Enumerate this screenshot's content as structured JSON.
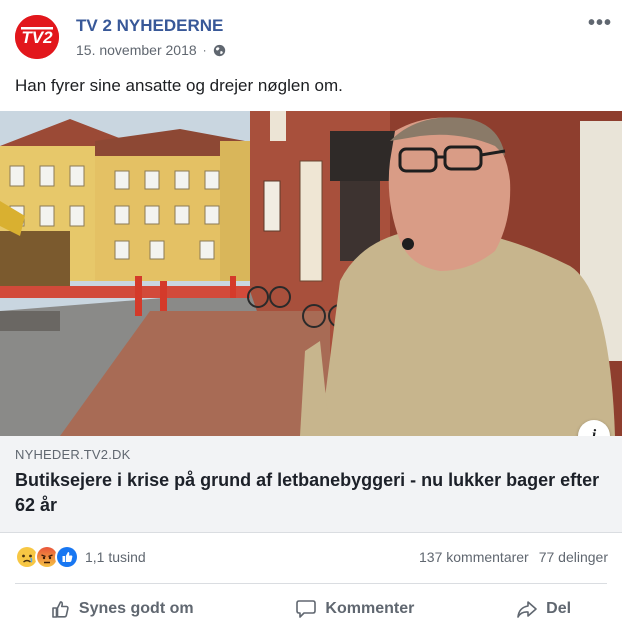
{
  "post": {
    "page_name": "TV 2 NYHEDERNE",
    "date": "15. november 2018",
    "privacy_icon": "globe-icon",
    "more_label": "•••",
    "text": "Han fyrer sine ansatte og drejer nøglen om.",
    "logo_text": "TV2"
  },
  "link": {
    "domain": "NYHEDER.TV2.DK",
    "title": "Butiksejere i krise på grund af letbanebyggeri - nu lukker bager efter 62 år",
    "info_label": "i"
  },
  "reactions": {
    "icons": [
      "sad-reaction-icon",
      "angry-reaction-icon",
      "like-reaction-icon"
    ],
    "count": "1,1 tusind",
    "comments": "137 kommentarer",
    "shares": "77 delinger"
  },
  "actions": {
    "like": "Synes godt om",
    "comment": "Kommenter",
    "share": "Del"
  },
  "colors": {
    "brand": "#e2171c",
    "link": "#385898",
    "secondary_text": "#606770",
    "link_box_bg": "#f2f3f5"
  }
}
